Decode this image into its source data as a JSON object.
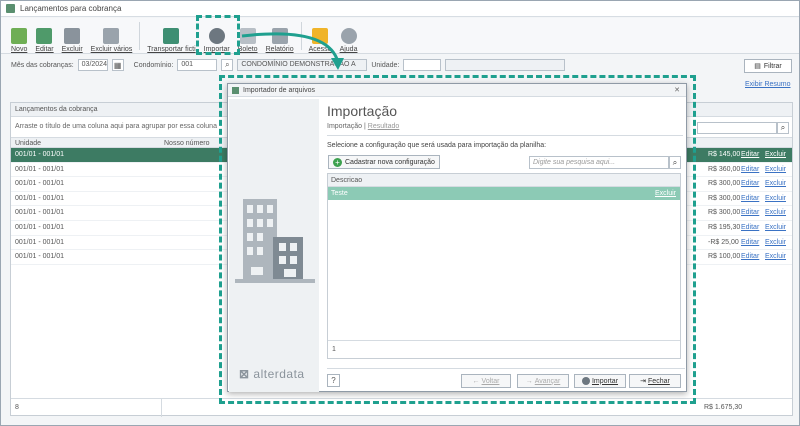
{
  "window": {
    "title": "Lançamentos para cobrança"
  },
  "toolbar": {
    "items": [
      {
        "label": "Novo",
        "icon": "new-icon",
        "color": "#6fae55"
      },
      {
        "label": "Editar",
        "icon": "edit-icon",
        "color": "#4f9a6a"
      },
      {
        "label": "Excluir",
        "icon": "trash-icon",
        "color": "#8a939c"
      },
      {
        "label": "Excluir vários",
        "icon": "trash-multiple-icon",
        "color": "#9aa3ac"
      },
      {
        "label": "Transportar ficti",
        "icon": "transport-icon",
        "color": "#3e8f73"
      },
      {
        "label": "Importar",
        "icon": "import-icon",
        "color": "#6d7780"
      },
      {
        "label": "Boleto",
        "icon": "boleto-icon",
        "color": "#b8bfc6"
      },
      {
        "label": "Relatório",
        "icon": "printer-icon",
        "color": "#9aa3ac"
      },
      {
        "label": "Acesso",
        "icon": "star-icon",
        "color": "#f0b429"
      },
      {
        "label": "Ajuda",
        "icon": "help-icon",
        "color": "#9aa3ac"
      }
    ]
  },
  "filters": {
    "mes_label": "Mês das cobranças:",
    "mes_value": "03/2024",
    "condominio_label": "Condomínio:",
    "condominio_code": "001",
    "condominio_name": "CONDOMÍNIO DEMONSTRAÇÃO A",
    "unidade_label": "Unidade:",
    "filtrar": "Filtrar",
    "exibir_resumo": "Exibir Resumo"
  },
  "grid": {
    "panel_title": "Lançamentos da cobrança",
    "group_hint": "Arraste o título de uma coluna aqui para agrupar por essa coluna",
    "columns": [
      "Unidade",
      "Nosso número"
    ],
    "rows": [
      {
        "unidade": "001/01 - 001/01",
        "valor": "R$ 145,00",
        "editar": "Editar",
        "excluir": "Excluir"
      },
      {
        "unidade": "001/01 - 001/01",
        "valor": "R$ 360,00",
        "editar": "Editar",
        "excluir": "Excluir"
      },
      {
        "unidade": "001/01 - 001/01",
        "valor": "R$ 300,00",
        "editar": "Editar",
        "excluir": "Excluir"
      },
      {
        "unidade": "001/01 - 001/01",
        "valor": "R$ 300,00",
        "editar": "Editar",
        "excluir": "Excluir"
      },
      {
        "unidade": "001/01 - 001/01",
        "valor": "R$ 300,00",
        "editar": "Editar",
        "excluir": "Excluir"
      },
      {
        "unidade": "001/01 - 001/01",
        "valor": "R$ 195,30",
        "editar": "Editar",
        "excluir": "Excluir"
      },
      {
        "unidade": "001/01 - 001/01",
        "valor": "-R$ 25,00",
        "editar": "Editar",
        "excluir": "Excluir"
      },
      {
        "unidade": "001/01 - 001/01",
        "valor": "R$ 100,00",
        "editar": "Editar",
        "excluir": "Excluir"
      }
    ],
    "footer_count": "8",
    "footer_total": "R$ 1.675,30"
  },
  "dialog": {
    "title": "Importador de arquivos",
    "heading": "Importação",
    "crumb_current": "Importação",
    "crumb_sep": "|",
    "crumb_next": "Resultado",
    "instruction": "Selecione a configuração que será usada para importação da planilha:",
    "add_button": "Cadastrar nova configuração",
    "search_placeholder": "Digite sua pesquisa aqui...",
    "column": "Descricao",
    "rows": [
      {
        "descricao": "Teste",
        "excluir": "Excluir"
      }
    ],
    "footer_count": "1",
    "help": "?",
    "buttons": {
      "voltar": "Voltar",
      "avancar": "Avançar",
      "importar": "Importar",
      "fechar": "Fechar"
    },
    "logo": "alterdata"
  },
  "colors": {
    "accent": "#1fa08f",
    "selected_row": "#3d7b63",
    "dialog_selected": "#8ccab5",
    "link": "#3a72c4"
  }
}
